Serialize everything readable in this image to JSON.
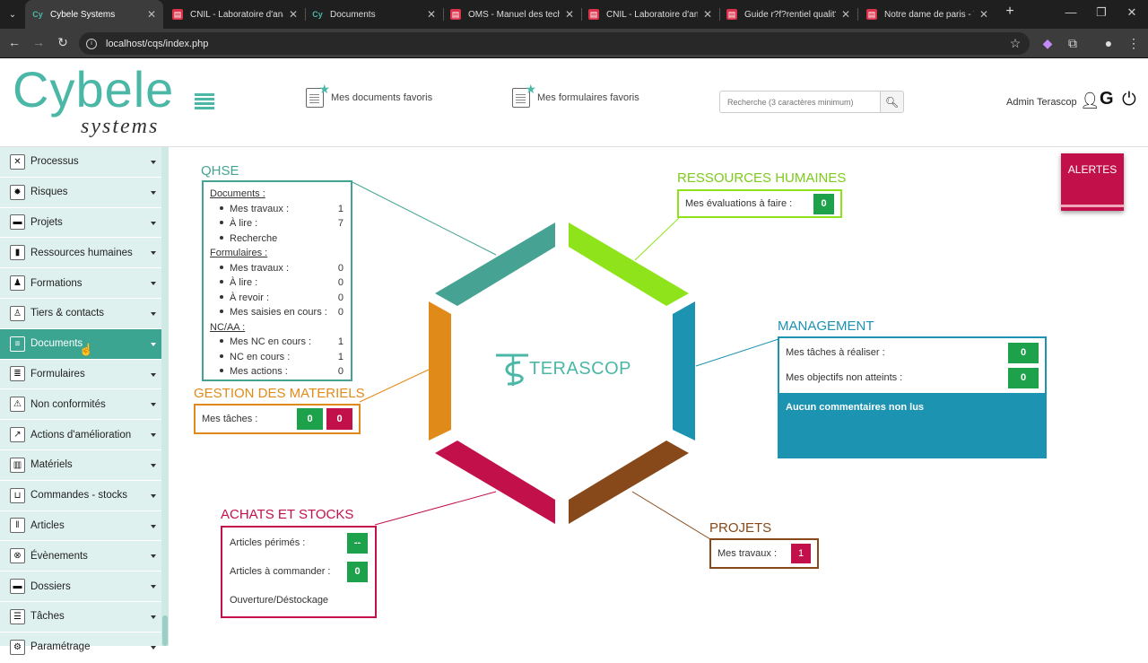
{
  "browser": {
    "tabs": [
      {
        "title": "Cybele Systems",
        "icon": "cybele-favicon"
      },
      {
        "title": "CNIL - Laboratoire d'analy",
        "icon": "doc-favicon"
      },
      {
        "title": "Documents",
        "icon": "cybele-favicon"
      },
      {
        "title": "OMS - Manuel des technic",
        "icon": "doc-favicon"
      },
      {
        "title": "CNIL - Laboratoire d'analy",
        "icon": "doc-favicon"
      },
      {
        "title": "Guide r?f?rentiel qualit? -",
        "icon": "doc-favicon"
      },
      {
        "title": "Notre dame de paris - Vi",
        "icon": "doc-favicon"
      }
    ],
    "url": "localhost/cqs/index.php"
  },
  "header": {
    "logo_main": "Cybele",
    "logo_sub": "systems",
    "fav_docs": "Mes documents favoris",
    "fav_forms": "Mes formulaires favoris",
    "search_placeholder": "Recherche (3 caractères minimum)",
    "user": "Admin Terascop"
  },
  "sidebar": {
    "items": [
      {
        "label": "Processus",
        "icon": "process-icon"
      },
      {
        "label": "Risques",
        "icon": "risk-icon"
      },
      {
        "label": "Projets",
        "icon": "folder-icon"
      },
      {
        "label": "Ressources humaines",
        "icon": "person-icon"
      },
      {
        "label": "Formations",
        "icon": "training-icon"
      },
      {
        "label": "Tiers & contacts",
        "icon": "contact-icon"
      },
      {
        "label": "Documents",
        "icon": "document-icon",
        "active": true
      },
      {
        "label": "Formulaires",
        "icon": "form-icon"
      },
      {
        "label": "Non conformités",
        "icon": "warning-icon"
      },
      {
        "label": "Actions d'amélioration",
        "icon": "chart-icon"
      },
      {
        "label": "Matériels",
        "icon": "equipment-icon"
      },
      {
        "label": "Commandes - stocks",
        "icon": "cart-icon"
      },
      {
        "label": "Articles",
        "icon": "barcode-icon"
      },
      {
        "label": "Évènements",
        "icon": "event-icon"
      },
      {
        "label": "Dossiers",
        "icon": "folder-icon"
      },
      {
        "label": "Tâches",
        "icon": "task-icon"
      },
      {
        "label": "Paramétrage",
        "icon": "settings-icon"
      }
    ]
  },
  "center_logo": "TERASCOP",
  "alert": {
    "label": "ALERTES"
  },
  "qhse": {
    "title": "QHSE",
    "documents_label": "Documents :",
    "documents": [
      {
        "label": "Mes travaux :",
        "value": "1"
      },
      {
        "label": "À lire :",
        "value": "7"
      },
      {
        "label": "Recherche",
        "value": ""
      }
    ],
    "forms_label": "Formulaires :",
    "forms": [
      {
        "label": "Mes travaux :",
        "value": "0"
      },
      {
        "label": "À lire :",
        "value": "0"
      },
      {
        "label": "À revoir :",
        "value": "0"
      },
      {
        "label": "Mes saisies en cours :",
        "value": "0"
      }
    ],
    "nc_label": "NC/AA :",
    "nc": [
      {
        "label": "Mes NC en cours :",
        "value": "1"
      },
      {
        "label": "NC en cours :",
        "value": "1"
      },
      {
        "label": "Mes actions :",
        "value": "0"
      }
    ]
  },
  "rh": {
    "title": "RESSOURCES HUMAINES",
    "label": "Mes évaluations à faire :",
    "value": "0"
  },
  "management": {
    "title": "MANAGEMENT",
    "row1_label": "Mes tâches à réaliser :",
    "row1_value": "0",
    "row2_label": "Mes objectifs non atteints :",
    "row2_value": "0",
    "comment": "Aucun commentaires non lus"
  },
  "materiels": {
    "title": "GESTION DES MATERIELS",
    "label": "Mes tâches :",
    "value1": "0",
    "value2": "0"
  },
  "achats": {
    "title": "ACHATS ET STOCKS",
    "row1_label": "Articles périmés :",
    "row1_value": "--",
    "row2_label": "Articles à commander :",
    "row2_value": "0",
    "row3_label": "Ouverture/Déstockage"
  },
  "projets": {
    "title": "PROJETS",
    "label": "Mes travaux :",
    "value": "1"
  },
  "colors": {
    "teal": "#4bb7a7",
    "green_badge": "#1ea14b",
    "red_badge": "#c2114a",
    "lime": "#8ee31a",
    "blue": "#1b93b1",
    "orange": "#e08a1a",
    "brown": "#87491a",
    "crimson": "#c2114a",
    "qhse_teal": "#46a393"
  }
}
